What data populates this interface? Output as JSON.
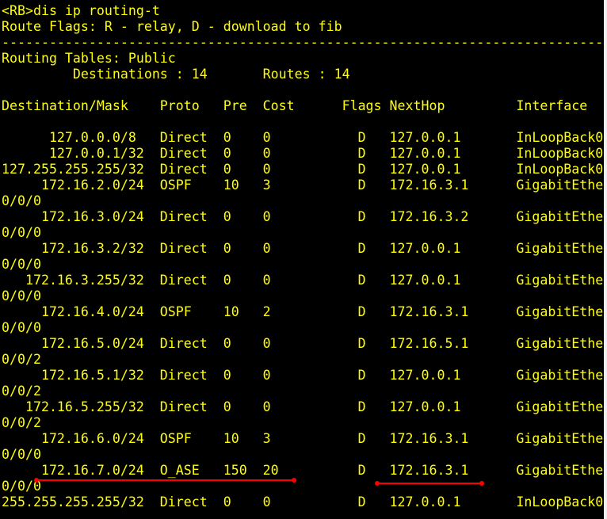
{
  "terminal": {
    "lines": [
      "<RB>dis ip routing-t",
      "Route Flags: R - relay, D - download to fib",
      "------------------------------------------------------------------------------",
      "Routing Tables: Public",
      "         Destinations : 14       Routes : 14",
      "",
      "Destination/Mask    Proto   Pre  Cost      Flags NextHop         Interface",
      "",
      "      127.0.0.0/8   Direct  0    0           D   127.0.0.1       InLoopBack0",
      "      127.0.0.1/32  Direct  0    0           D   127.0.0.1       InLoopBack0",
      "127.255.255.255/32  Direct  0    0           D   127.0.0.1       InLoopBack0",
      "     172.16.2.0/24  OSPF    10   3           D   172.16.3.1      GigabitEthe",
      "0/0/0",
      "     172.16.3.0/24  Direct  0    0           D   172.16.3.2      GigabitEthe",
      "0/0/0",
      "     172.16.3.2/32  Direct  0    0           D   127.0.0.1       GigabitEthe",
      "0/0/0",
      "   172.16.3.255/32  Direct  0    0           D   127.0.0.1       GigabitEthe",
      "0/0/0",
      "     172.16.4.0/24  OSPF    10   2           D   172.16.3.1      GigabitEthe",
      "0/0/0",
      "     172.16.5.0/24  Direct  0    0           D   172.16.5.1      GigabitEthe",
      "0/0/2",
      "     172.16.5.1/32  Direct  0    0           D   127.0.0.1       GigabitEthe",
      "0/0/2",
      "   172.16.5.255/32  Direct  0    0           D   127.0.0.1       GigabitEthe",
      "0/0/2",
      "     172.16.6.0/24  OSPF    10   3           D   172.16.3.1      GigabitEthe",
      "0/0/0",
      "     172.16.7.0/24  O_ASE   150  20          D   172.16.3.1      GigabitEthe",
      "0/0/0",
      "255.255.255.255/32  Direct  0    0           D   127.0.0.1       InLoopBack0"
    ]
  },
  "colors": {
    "background": "#000000",
    "text": "#ffff00",
    "annotation": "#ff0000"
  }
}
